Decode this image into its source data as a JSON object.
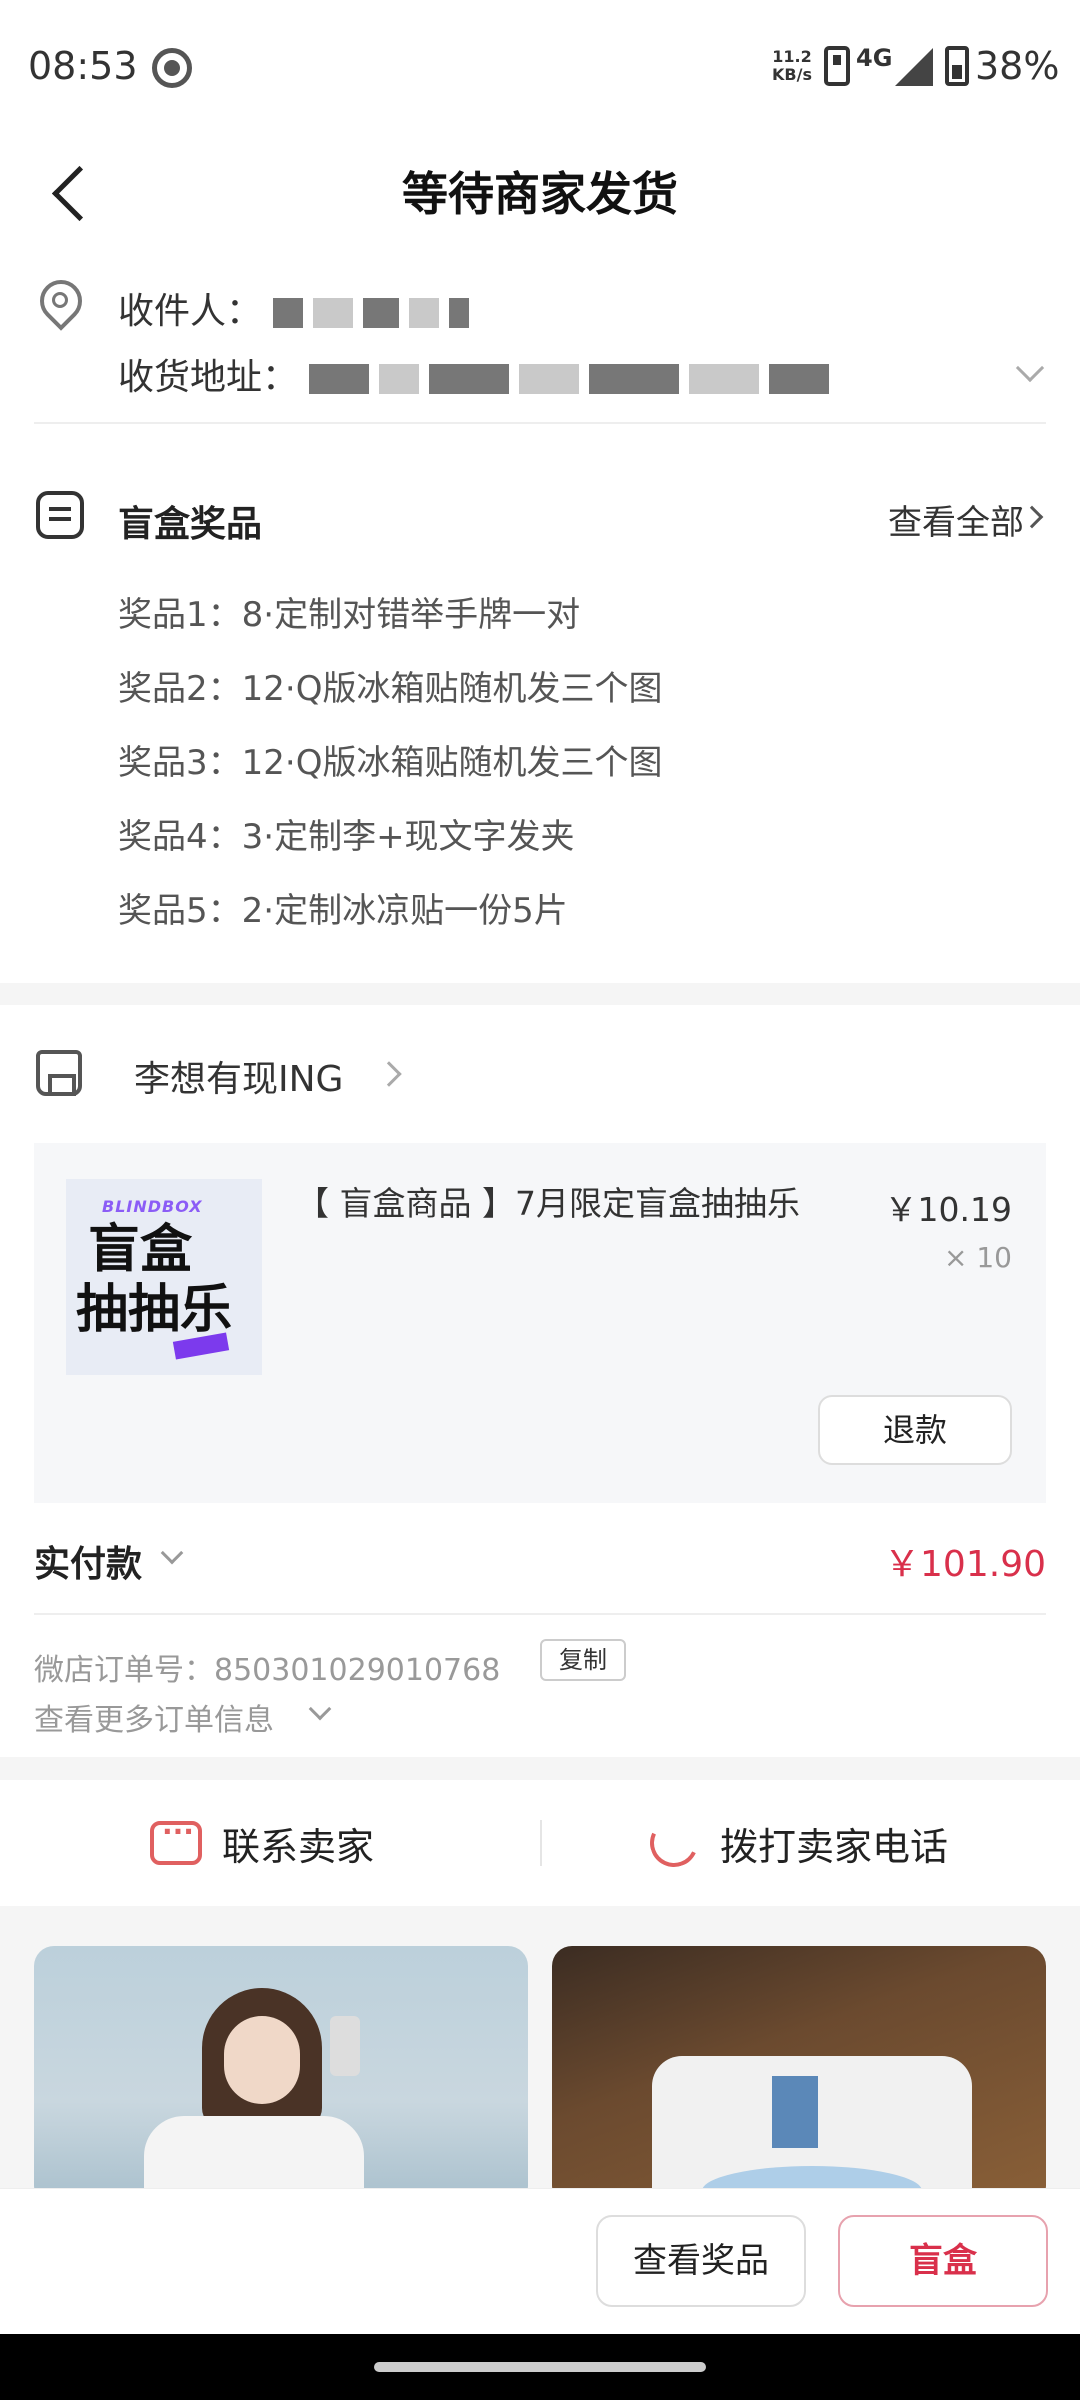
{
  "status_bar": {
    "time": "08:53",
    "speed_top": "11.2",
    "speed_bottom": "KB/s",
    "network": "4G",
    "battery": "38%"
  },
  "header": {
    "title": "等待商家发货",
    "back_icon": "chevron-left-icon"
  },
  "address": {
    "recipient_label": "收件人：",
    "address_label": "收货地址：",
    "icon": "location-pin-icon"
  },
  "prizes": {
    "title": "盲盒奖品",
    "view_all": "查看全部",
    "items": [
      "奖品1：8·定制对错举手牌一对",
      "奖品2：12·Q版冰箱贴随机发三个图",
      "奖品3：12·Q版冰箱贴随机发三个图",
      "奖品4：3·定制李+现文字发夹",
      "奖品5：2·定制冰凉贴一份5片"
    ]
  },
  "shop": {
    "name": "李想有现ING",
    "icon": "shop-icon"
  },
  "goods": {
    "thumb_top": "BLINDBOX",
    "thumb_line1": "盲盒",
    "thumb_line2": "抽抽乐",
    "title": "【 盲盒商品 】7月限定盲盒抽抽乐",
    "price": "￥10.19",
    "qty": "× 10",
    "refund": "退款"
  },
  "payment": {
    "label": "实付款",
    "amount": "￥101.90",
    "order_no": "微店订单号：850301029010768",
    "copy": "复制",
    "more_info": "查看更多订单信息"
  },
  "contact": {
    "seller": "联系卖家",
    "call": "拨打卖家电话"
  },
  "actions": {
    "view_prizes": "查看奖品",
    "blind_box": "盲盒"
  },
  "colors": {
    "accent": "#d9304b",
    "icon_red": "#e06060"
  }
}
